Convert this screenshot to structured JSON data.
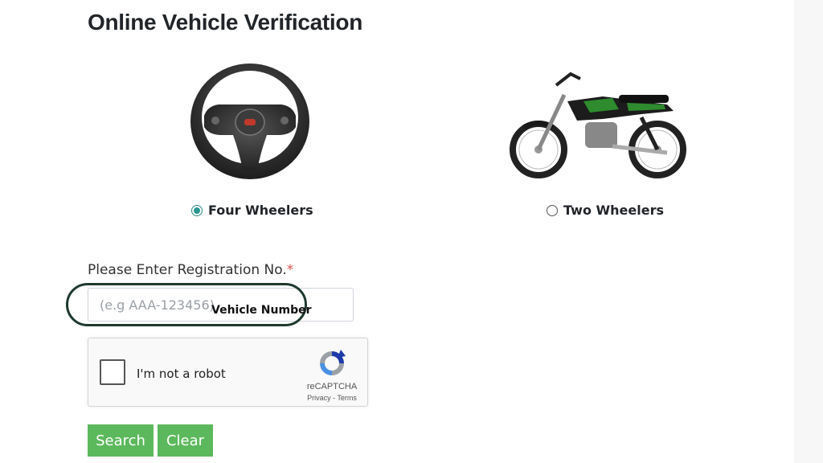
{
  "page": {
    "title": "Online Vehicle Verification"
  },
  "vehicle_types": {
    "four": {
      "label": "Four Wheelers",
      "selected": true,
      "image_icon": "steering-wheel-icon"
    },
    "two": {
      "label": "Two Wheelers",
      "selected": false,
      "image_icon": "motorcycle-icon"
    }
  },
  "registration": {
    "label": "Please Enter Registration No.",
    "required_mark": "*",
    "placeholder": "(e.g AAA-123456)",
    "value": ""
  },
  "annotation": {
    "text": "Vehicle Number"
  },
  "captcha": {
    "checkbox_label": "I'm not a robot",
    "brand": "reCAPTCHA",
    "links": "Privacy - Terms"
  },
  "buttons": {
    "search": "Search",
    "clear": "Clear"
  },
  "colors": {
    "button": "#5cb85c",
    "radio_selected": "#2a9595",
    "required": "#d9534f",
    "annotation_oval": "#1f3a2e"
  }
}
